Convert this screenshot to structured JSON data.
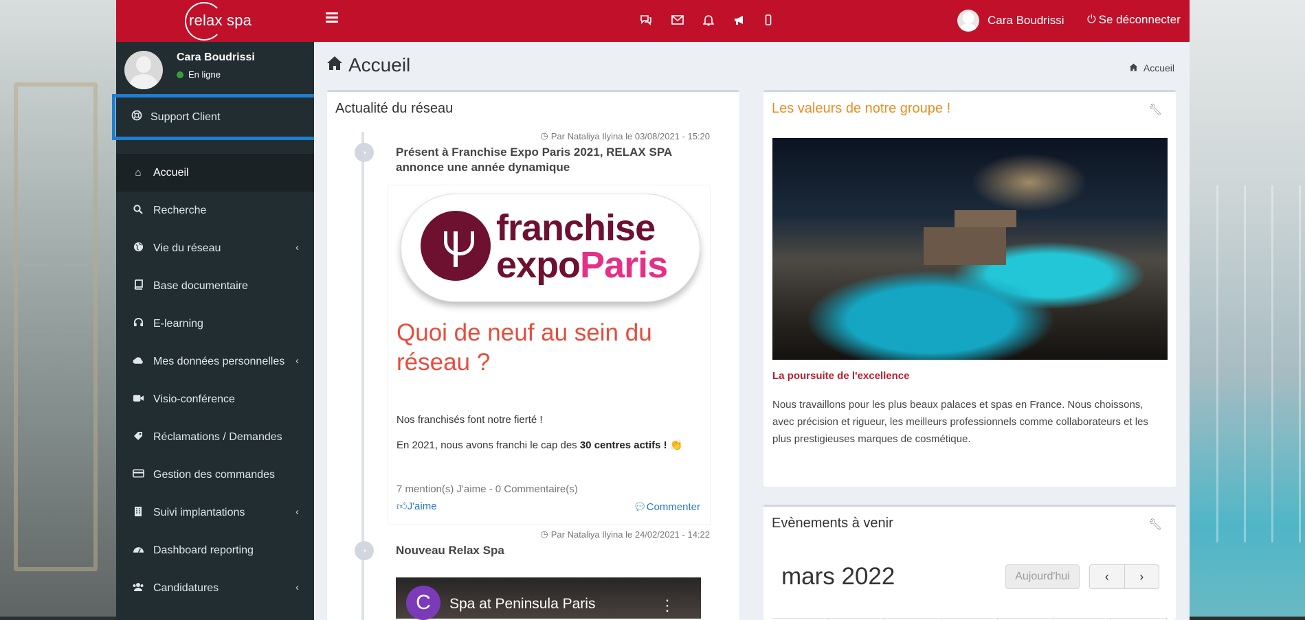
{
  "header": {
    "logo_text": "relax spa",
    "user_name": "Cara Boudrissi",
    "logout_label": "Se déconnecter",
    "icons": [
      "comments-icon",
      "envelope-icon",
      "bell-icon",
      "bullhorn-icon",
      "mobile-icon"
    ]
  },
  "sidebar": {
    "user_name": "Cara Boudrissi",
    "status": "En ligne",
    "support_label": "Support Client",
    "items": [
      {
        "label": "Accueil",
        "icon": "home-icon",
        "active": true
      },
      {
        "label": "Recherche",
        "icon": "search-icon"
      },
      {
        "label": "Vie du réseau",
        "icon": "globe-icon",
        "has_submenu": true
      },
      {
        "label": "Base documentaire",
        "icon": "book-icon"
      },
      {
        "label": "E-learning",
        "icon": "headset-icon"
      },
      {
        "label": "Mes données personnelles",
        "icon": "cloud-icon",
        "has_submenu": true
      },
      {
        "label": "Visio-conférence",
        "icon": "video-camera-icon"
      },
      {
        "label": "Réclamations / Demandes",
        "icon": "tag-icon"
      },
      {
        "label": "Gestion des commandes",
        "icon": "credit-card-icon"
      },
      {
        "label": "Suivi implantations",
        "icon": "building-icon",
        "has_submenu": true
      },
      {
        "label": "Dashboard reporting",
        "icon": "dashboard-icon"
      },
      {
        "label": "Candidatures",
        "icon": "users-icon",
        "has_submenu": true
      }
    ]
  },
  "page": {
    "title": "Accueil",
    "breadcrumb": "Accueil"
  },
  "news": {
    "title": "Actualité du réseau",
    "posts": [
      {
        "meta": "Par Nataliya Ilyina le 03/08/2021 - 15:20",
        "title": "Présent à Franchise Expo Paris 2021, RELAX SPA annonce une année dynamique",
        "logo_line1": "franchise",
        "logo_line2a": "expo",
        "logo_line2b": "Paris",
        "headline": "Quoi de neuf au sein du réseau ?",
        "p1": "Nos franchisés font notre fierté !",
        "p2_before": "En 2021, nous avons franchi le cap des ",
        "p2_bold": "30 centres actifs !",
        "p2_emoji": "👏",
        "stats": "7 mention(s) J'aime - 0 Commentaire(s)",
        "like_label": "J'aime",
        "comment_label": "Commenter"
      },
      {
        "meta": "Par Nataliya Ilyina le 24/02/2021 - 14:22",
        "title": "Nouveau Relax Spa",
        "video_title": "Spa at Peninsula Paris",
        "video_channel_initial": "C"
      }
    ]
  },
  "values": {
    "title": "Les valeurs de notre groupe !",
    "heading": "La poursuite de l'excellence",
    "text": "Nous travaillons pour les plus beaux palaces et spas en France. Nous choissons, avec précision et rigueur, les meilleurs professionnels comme collaborateurs et les plus prestigieuses marques de cosmétique."
  },
  "events": {
    "title": "Evènements à venir",
    "month": "mars 2022",
    "today_label": "Aujourd'hui",
    "prev_label": "‹",
    "next_label": "›"
  },
  "colors": {
    "topbar": "#c0102a",
    "sidebar": "#222d32",
    "highlight": "#1e7ecf",
    "accent_orange": "#e88d24",
    "headline_red": "#e74c3c",
    "link_blue": "#2a78c2"
  }
}
